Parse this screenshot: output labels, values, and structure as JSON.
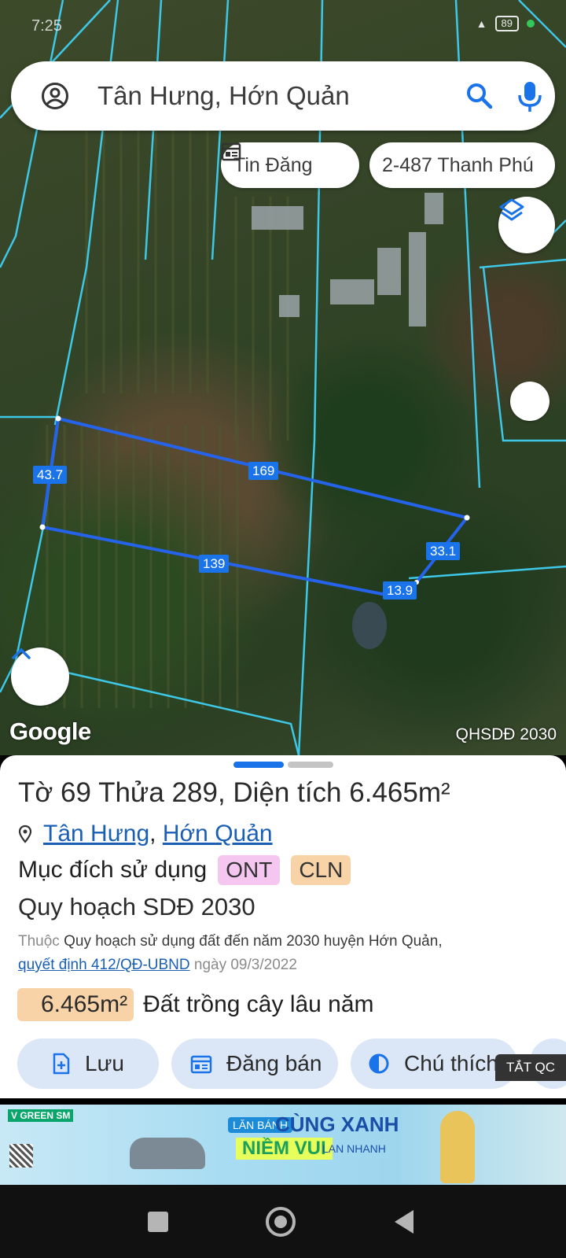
{
  "status_bar": {
    "time": "7:25",
    "battery": "89"
  },
  "search": {
    "query": "Tân Hưng, Hớn Quản"
  },
  "chips": {
    "news": "Tin Đăng",
    "address": "2-487 Thanh Phú"
  },
  "map": {
    "watermark": "Google",
    "layer_name": "QHSDĐ 2030",
    "dimensions": {
      "left": "43.7",
      "top": "169",
      "bottom": "139",
      "right": "33.1",
      "corner": "13.9"
    }
  },
  "parcel": {
    "title": "Tờ 69 Thửa 289, Diện tích 6.465m²",
    "location": {
      "commune": "Tân Hưng",
      "separator": ",",
      "district": "Hớn Quản"
    },
    "purpose_label": "Mục đích sử dụng",
    "purpose_tags": [
      "ONT",
      "CLN"
    ],
    "plan_title": "Quy hoạch SDĐ 2030",
    "plan_prefix": "Thuộc",
    "plan_name": "Quy hoạch sử dụng đất đến năm 2030 huyện Hớn Quản,",
    "plan_decision": "quyết định 412/QĐ-UBND",
    "plan_date": "ngày 09/3/2022",
    "area_value": "6.465m²",
    "area_type": "Đất trồng cây lâu năm"
  },
  "actions": {
    "save": "Lưu",
    "sell": "Đăng bán",
    "note": "Chú thích"
  },
  "ad": {
    "close_label": "TẮT QC",
    "brand": "V GREEN SM",
    "line1": "LĂN BÁNH",
    "line2": "CÙNG XANH",
    "line3": "NIỀM VUI",
    "line4": "LAN NHANH"
  },
  "colors": {
    "accent": "#1a73e8",
    "ont_tag": "#f5c6ef",
    "cln_tag": "#f8d3a8",
    "action_bg": "#dbe6f7"
  }
}
